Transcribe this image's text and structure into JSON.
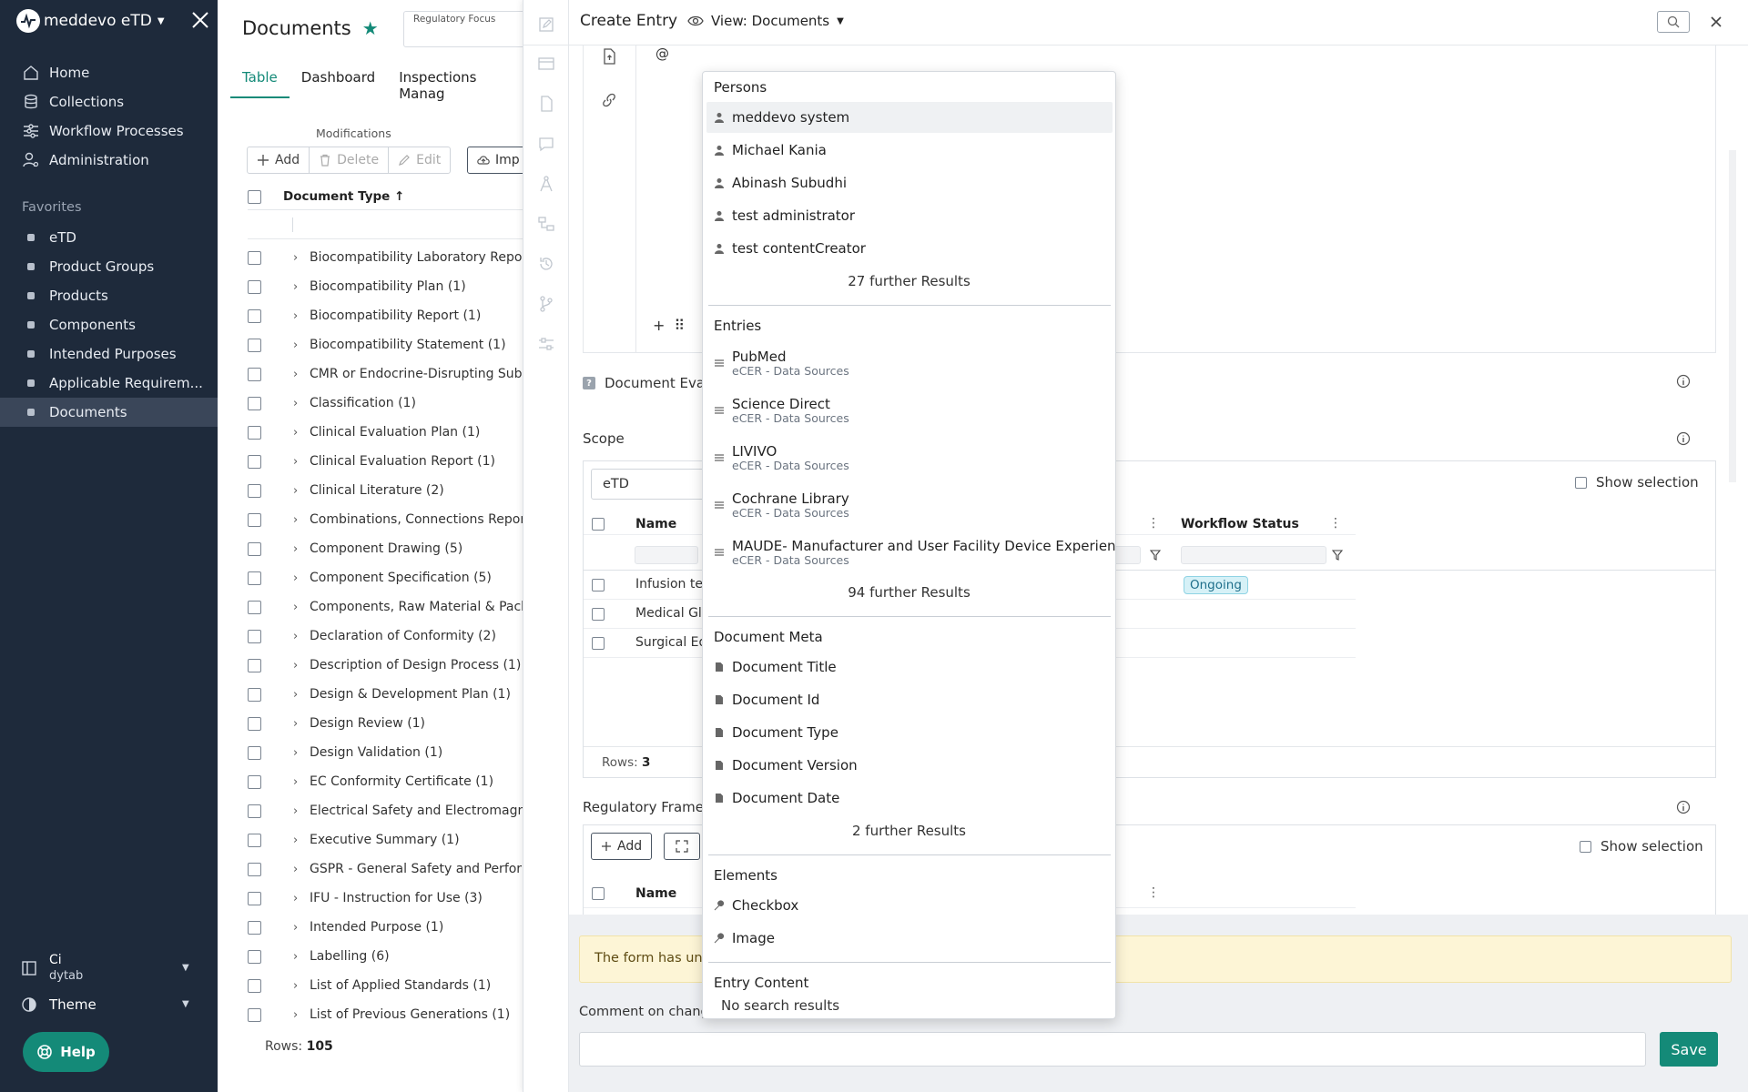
{
  "sidebar": {
    "brand": "meddevo eTD",
    "nav": [
      {
        "label": "Home"
      },
      {
        "label": "Collections"
      },
      {
        "label": "Workflow Processes"
      },
      {
        "label": "Administration"
      }
    ],
    "favorites_title": "Favorites",
    "favorites": [
      {
        "label": "eTD"
      },
      {
        "label": "Product Groups"
      },
      {
        "label": "Products"
      },
      {
        "label": "Components"
      },
      {
        "label": "Intended Purposes"
      },
      {
        "label": "Applicable Requirem..."
      },
      {
        "label": "Documents",
        "active": true
      }
    ],
    "user": {
      "name": "Ci",
      "org": "dytab"
    },
    "theme_label": "Theme",
    "help_label": "Help"
  },
  "documents": {
    "title": "Documents",
    "regulatory_focus_label": "Regulatory Focus",
    "tabs": [
      "Table",
      "Dashboard",
      "Inspections Manag"
    ],
    "modifications_label": "Modifications",
    "toolbar": {
      "add": "Add",
      "delete": "Delete",
      "edit": "Edit",
      "import": "Imp"
    },
    "column_header": "Document Type",
    "sort_arrow": "↑",
    "rows": [
      "Biocompatibility Laboratory Report (",
      "Biocompatibility Plan (1)",
      "Biocompatibility Report (1)",
      "Biocompatibility Statement (1)",
      "CMR or Endocrine-Disrupting Substa",
      "Classification (1)",
      "Clinical Evaluation Plan (1)",
      "Clinical Evaluation Report (1)",
      "Clinical Literature (2)",
      "Combinations, Connections Report (",
      "Component Drawing (5)",
      "Component Specification (5)",
      "Components, Raw Material & Packa",
      "Declaration of Conformity (2)",
      "Description of Design Process (1)",
      "Design & Development Plan (1)",
      "Design Review (1)",
      "Design Validation (1)",
      "EC Conformity Certificate (1)",
      "Electrical Safety and Electromagnet",
      "Executive Summary (1)",
      "GSPR - General Safety and Performa",
      "IFU - Instruction for Use (3)",
      "Intended Purpose (1)",
      "Labelling (6)",
      "List of Applied Standards (1)",
      "List of Previous Generations (1)"
    ],
    "rows_label": "Rows:",
    "rows_count": "105"
  },
  "panel": {
    "title": "Create Entry",
    "view_label": "View: Documents",
    "editor_text": "@",
    "doc_eval_label": "Document Eva",
    "scope": {
      "label": "Scope",
      "filter_value": "eTD",
      "show_selection": "Show selection",
      "col_name": "Name",
      "col_workflow": "Workflow Status",
      "rows": [
        {
          "name": "Infusion tec",
          "status": "Ongoing"
        },
        {
          "name": "Medical Glo",
          "status": ""
        },
        {
          "name": "Surgical Equ",
          "status": ""
        }
      ],
      "rows_label": "Rows:",
      "rows_count": "3"
    },
    "regulatory": {
      "label": "Regulatory Framew",
      "add": "Add",
      "show_selection": "Show selection",
      "col_name": "Name"
    },
    "warning": "The form has uns",
    "comment_label": "Comment on chang",
    "save": "Save"
  },
  "mention": {
    "persons_title": "Persons",
    "persons": [
      "meddevo system",
      "Michael Kania",
      "Abinash Subudhi",
      "test administrator",
      "test contentCreator"
    ],
    "persons_more": "27 further Results",
    "entries_title": "Entries",
    "entries": [
      {
        "title": "PubMed",
        "sub": "eCER - Data Sources"
      },
      {
        "title": "Science Direct",
        "sub": "eCER - Data Sources"
      },
      {
        "title": "LIVIVO",
        "sub": "eCER - Data Sources"
      },
      {
        "title": "Cochrane Library",
        "sub": "eCER - Data Sources"
      },
      {
        "title": "MAUDE- Manufacturer and User Facility Device Experience",
        "sub": "eCER - Data Sources"
      }
    ],
    "entries_more": "94 further Results",
    "meta_title": "Document Meta",
    "meta": [
      "Document Title",
      "Document Id",
      "Document Type",
      "Document Version",
      "Document Date"
    ],
    "meta_more": "2 further Results",
    "elements_title": "Elements",
    "elements": [
      "Checkbox",
      "Image"
    ],
    "content_title": "Entry Content",
    "content_none": "No search results"
  },
  "colors": {
    "accent": "#148a78",
    "sidebar_bg": "#1e2a3b",
    "warning_bg": "#fdf5d6",
    "badge_bg": "#d6f1f7"
  }
}
